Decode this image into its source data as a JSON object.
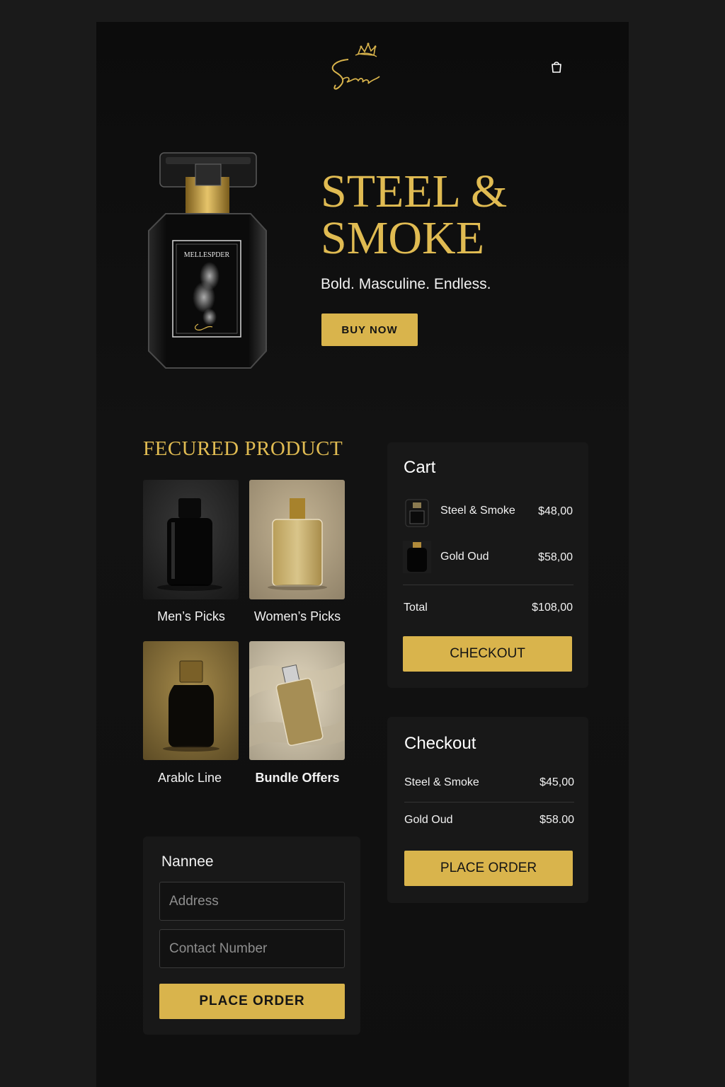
{
  "brand": {
    "logo_text": "Seenbra"
  },
  "header": {
    "cart_icon": "shopping-bag-icon"
  },
  "hero": {
    "bottle_label": "MELLESPDER",
    "title_line1": "STEEL &",
    "title_line2": "SMOKE",
    "subtitle": "Bold. Masculine. Endless.",
    "buy_label": "BUY NOW"
  },
  "featured": {
    "title": "FECURED PRODUCT",
    "items": [
      {
        "label": "Men’s Picks"
      },
      {
        "label": "Women’s Picks"
      },
      {
        "label": "Arablc Line"
      },
      {
        "label": "Bundle Offers"
      }
    ]
  },
  "cart": {
    "title": "Cart",
    "items": [
      {
        "name": "Steel & Smoke",
        "price": "$48,00"
      },
      {
        "name": "Gold Oud",
        "price": "$58,00"
      }
    ],
    "total_label": "Total",
    "total_value": "$108,00",
    "checkout_label": "CHECKOUT"
  },
  "checkout": {
    "title": "Checkout",
    "items": [
      {
        "name": "Steel & Smoke",
        "price": "$45,00"
      },
      {
        "name": "Gold Oud",
        "price": "$58.00"
      }
    ],
    "place_order_label": "PLACE ORDER"
  },
  "form": {
    "name_label": "Nannee",
    "address_placeholder": "Address",
    "contact_placeholder": "Contact Number",
    "place_order_label": "PLACE ORDER"
  },
  "colors": {
    "accent_gold": "#d9b44c",
    "heading_gold": "#e0bb52",
    "background": "#0f0f0f",
    "panel": "#181818"
  }
}
